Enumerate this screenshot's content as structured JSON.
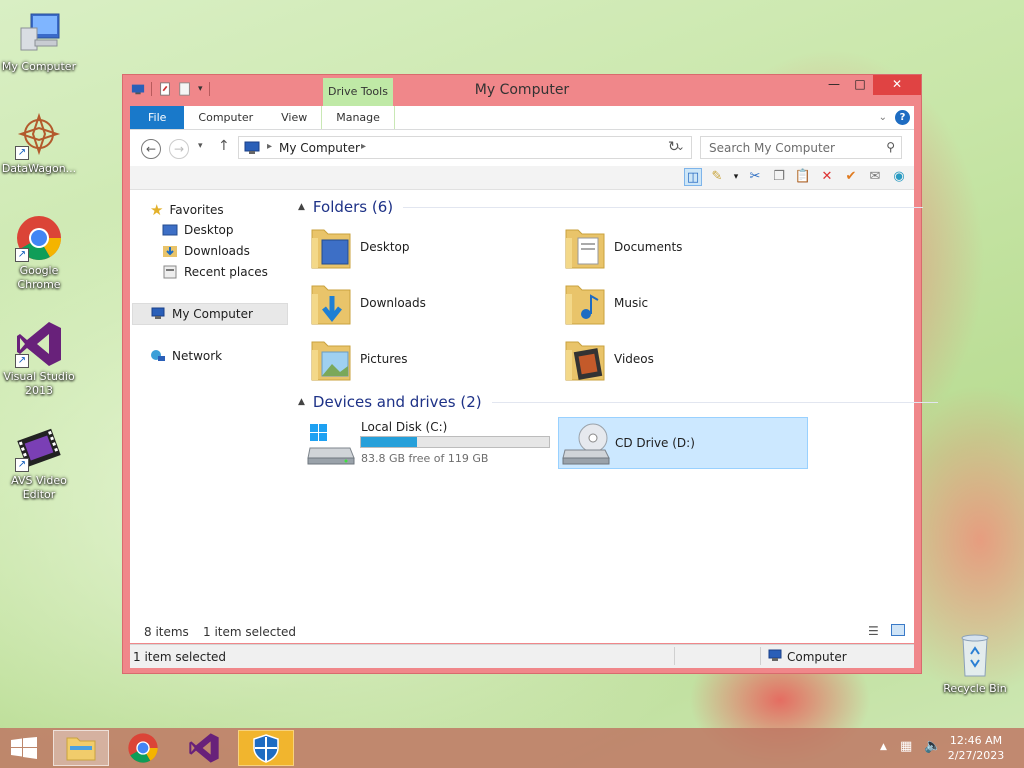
{
  "desktop": {
    "icons": [
      {
        "label": "My Computer",
        "icon": "computer-icon"
      },
      {
        "label": "DataWagon...",
        "icon": "datawagon-icon"
      },
      {
        "label": "Google Chrome",
        "icon": "chrome-icon"
      },
      {
        "label": "Visual Studio 2013",
        "icon": "visual-studio-icon"
      },
      {
        "label": "AVS Video Editor",
        "icon": "film-icon"
      },
      {
        "label": "Recycle Bin",
        "icon": "recycle-bin-icon"
      }
    ]
  },
  "window": {
    "title": "My Computer",
    "contextual_tab": "Drive Tools",
    "ribbon_tabs": [
      "File",
      "Computer",
      "View",
      "Manage"
    ],
    "address": {
      "location": "My Computer"
    },
    "search_placeholder": "Search My Computer",
    "nav_pane": {
      "favorites_label": "Favorites",
      "favorites": [
        "Desktop",
        "Downloads",
        "Recent places"
      ],
      "my_computer": "My Computer",
      "network": "Network"
    },
    "folders_header": "Folders (6)",
    "folders": [
      "Desktop",
      "Documents",
      "Downloads",
      "Music",
      "Pictures",
      "Videos"
    ],
    "drives_header": "Devices and drives (2)",
    "drives": [
      {
        "name": "Local Disk (C:)",
        "free_text": "83.8 GB free of 119 GB",
        "used_fraction": 0.3
      },
      {
        "name": "CD Drive (D:)"
      }
    ],
    "status": {
      "items_count": "8 items",
      "selected": "1 item selected",
      "bottom_selected": "1 item selected",
      "bottom_location": "Computer"
    }
  },
  "taskbar": {
    "time": "12:46 AM",
    "date": "2/27/2023"
  },
  "colors": {
    "accent": "#1979ca",
    "window_frame": "#f0878a",
    "selection": "#cce8ff",
    "drive_bar": "#26a0da"
  }
}
